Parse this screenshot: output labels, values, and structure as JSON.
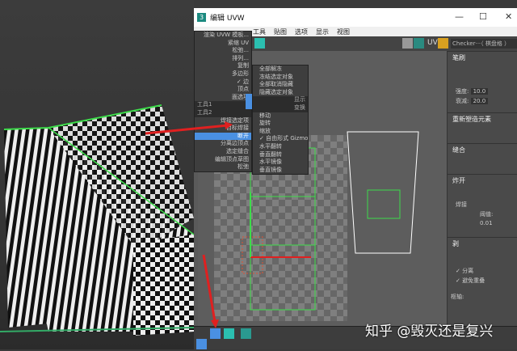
{
  "window": {
    "title": "编辑 UVW",
    "minimize": "—",
    "maximize": "☐",
    "close": "✕"
  },
  "menubar": [
    "工具",
    "贴图",
    "选项",
    "显示",
    "视图"
  ],
  "toolbar": {
    "uv_label": "UV",
    "texture_dropdown": "Checker···（ 棋盘格 ）"
  },
  "context_menu": {
    "items": [
      "渲染 UVW 模板...",
      "紧缩 UV",
      "松弛...",
      "排列...",
      "复制",
      "多边形",
      "边",
      "顶点",
      "面选项",
      "工具1",
      "工具2",
      "焊接选定项",
      "目标焊接",
      "断开",
      "分离边顶点",
      "选定缝合",
      "编辑顶点草图",
      "松弛"
    ],
    "highlighted": "断开",
    "checked": "边"
  },
  "submenu": {
    "items": [
      "全部解冻",
      "冻结选定对象",
      "全部取消隐藏",
      "隐藏选定对象",
      "移动",
      "旋转",
      "缩放",
      "自由形式 Gizmo",
      "水平翻转",
      "垂直翻转",
      "水平镜像",
      "垂直镜像"
    ],
    "checked": "自由形式 Gizmo",
    "header_right_1": "显示",
    "header_right_2": "变换"
  },
  "panel": {
    "brush": "笔刷",
    "strength_label": "强度:",
    "strength": "10.0",
    "falloff_label": "衰减:",
    "falloff": "20.0",
    "reshape": "重新塑造元素",
    "stitch": "缝合",
    "explode": "炸开",
    "weld": "焊接",
    "threshold_label": "阈值:",
    "threshold": "0.01",
    "peel": "剥",
    "detach": "分离",
    "avoid_overlap": "避免重叠",
    "pivot": "枢轴:"
  },
  "watermark": "知乎 @毁灭还是复兴",
  "colors": {
    "accent": "#4a90e2",
    "teal": "#2bbfb0",
    "uv_green": "#3ddc4a"
  }
}
